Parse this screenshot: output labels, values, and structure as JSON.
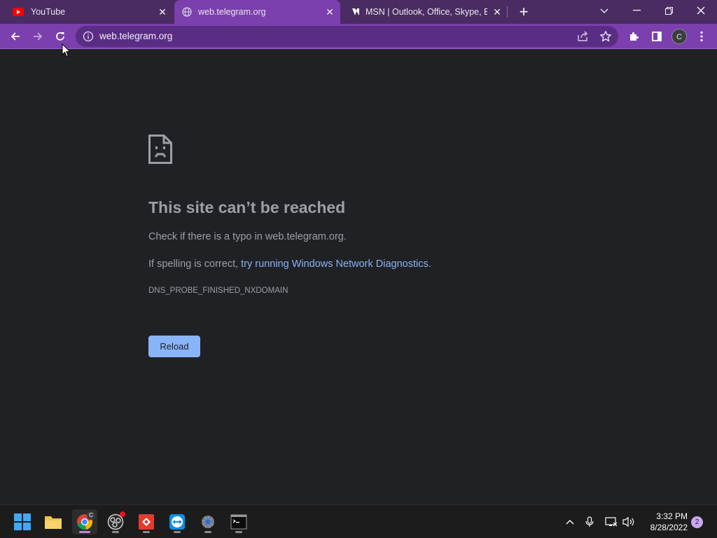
{
  "tabs": [
    {
      "title": "YouTube",
      "icon": "youtube-icon",
      "active": false
    },
    {
      "title": "web.telegram.org",
      "icon": "globe-icon",
      "active": true
    },
    {
      "title": "MSN | Outlook, Office, Skype, Bing",
      "icon": "msn-icon",
      "active": false
    }
  ],
  "toolbar": {
    "url": "web.telegram.org",
    "profile_initial": "C"
  },
  "error": {
    "title": "This site can’t be reached",
    "line1": "Check if there is a typo in web.telegram.org.",
    "line2_prefix": "If spelling is correct, ",
    "line2_link": "try running Windows Network Diagnostics",
    "line2_suffix": ".",
    "code": "DNS_PROBE_FINISHED_NXDOMAIN",
    "reload_label": "Reload"
  },
  "taskbar": {
    "apps": [
      "start-icon",
      "file-explorer-icon",
      "chrome-icon",
      "obs-icon",
      "anydesk-icon",
      "teamviewer-icon",
      "settings-icon",
      "terminal-icon"
    ],
    "chrome_badge": "C",
    "time": "3:32 PM",
    "date": "8/28/2022",
    "notifications": "2"
  },
  "colors": {
    "tabstrip": "#4a2c63",
    "toolbar": "#7b3fae",
    "page_bg": "#202124",
    "link": "#8ab4f8",
    "button": "#8ab4f8"
  }
}
